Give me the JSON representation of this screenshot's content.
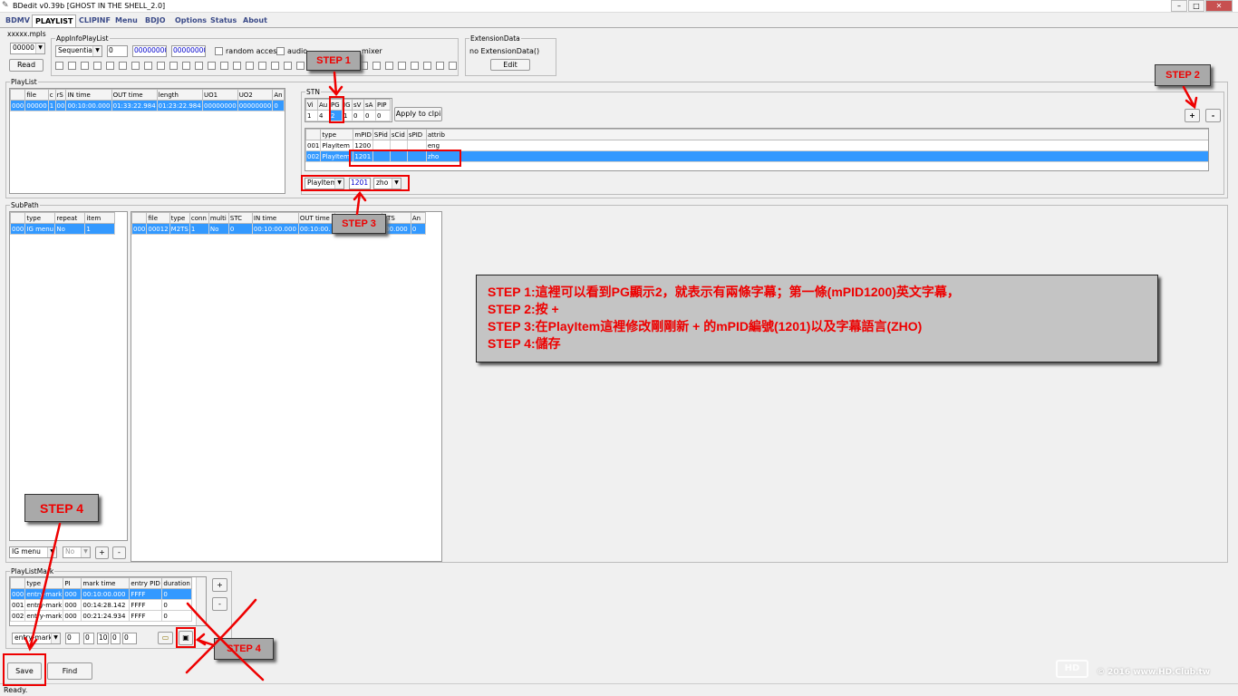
{
  "window": {
    "title": "BDedit v0.39b [GHOST IN THE SHELL_2.0]",
    "minimize": "–",
    "maximize": "□",
    "close": "✕"
  },
  "tabs": [
    "BDMV",
    "PLAYLIST",
    "CLIPINF",
    "Menu",
    "BDJO",
    "Options",
    "Status",
    "About"
  ],
  "file": {
    "label": "xxxxx.mpls",
    "number": "00000",
    "read_label": "Read"
  },
  "appinfo": {
    "label": "AppInfoPlayList",
    "mode": "Sequential",
    "count": "0",
    "hex1": "00000000",
    "hex2": "00000000",
    "random_access": "random access",
    "audio": "audio",
    "mixer": "mixer"
  },
  "extension": {
    "label": "ExtensionData",
    "text": "no ExtensionData()",
    "edit_label": "Edit"
  },
  "playlist": {
    "label": "PlayList",
    "columns": [
      "",
      "file",
      "c",
      "rS",
      "IN time",
      "OUT time",
      "length",
      "UO1",
      "UO2",
      "An"
    ],
    "rows": [
      [
        "000",
        "00000",
        "1",
        "00",
        "00:10:00.000",
        "01:33:22.984",
        "01:23:22.984",
        "00000000",
        "00000000",
        "0"
      ]
    ]
  },
  "stn": {
    "label": "STN",
    "counts_header": [
      "Vi",
      "Au",
      "PG",
      "IG",
      "sV",
      "sA",
      "PIP"
    ],
    "counts": [
      "1",
      "4",
      "2",
      "1",
      "0",
      "0",
      "0"
    ],
    "apply_label": "Apply to clpi",
    "plus_label": "+",
    "minus_label": "-",
    "columns": [
      "",
      "type",
      "mPID",
      "SPid",
      "sCid",
      "sPID",
      "attrib"
    ],
    "rows": [
      [
        "001",
        "PlayItem",
        "1200",
        "",
        "",
        "",
        "eng"
      ],
      [
        "002",
        "PlayItem",
        "1201",
        "",
        "",
        "",
        "zho"
      ]
    ],
    "edit_type": "PlayItem",
    "edit_pid": "1201",
    "edit_lang": "zho"
  },
  "subpath": {
    "label": "SubPath",
    "columns": [
      "",
      "type",
      "repeat",
      "item"
    ],
    "rows": [
      [
        "000",
        "IG menu",
        "No",
        "1"
      ]
    ],
    "type_select": "IG menu",
    "repeat_select": "No",
    "plus_label": "+",
    "minus_label": "-",
    "clip_columns": [
      "",
      "file",
      "type",
      "conn",
      "multi",
      "STC",
      "IN time",
      "OUT time",
      "",
      "PTS",
      "An"
    ],
    "clip_rows": [
      [
        "000",
        "00012",
        "M2TS",
        "1",
        "No",
        "0",
        "00:10:00.000",
        "00:10:00.",
        "",
        ":00.000",
        "0"
      ]
    ]
  },
  "marks": {
    "label": "PlayListMark",
    "columns": [
      "",
      "type",
      "PI",
      "mark time",
      "entry PID",
      "duration"
    ],
    "rows": [
      [
        "000",
        "entry-mark",
        "000",
        "00:10:00.000",
        "FFFF",
        "0"
      ],
      [
        "001",
        "entry-mark",
        "000",
        "00:14:28.142",
        "FFFF",
        "0"
      ],
      [
        "002",
        "entry-mark",
        "000",
        "00:21:24.934",
        "FFFF",
        "0"
      ]
    ],
    "type_select": "entry-mark",
    "fields": [
      "0",
      "0",
      "10",
      "0",
      "0"
    ],
    "plus_label": "+",
    "minus_label": "-"
  },
  "footer": {
    "save_label": "Save",
    "find_label": "Find",
    "status": "Ready.",
    "watermark": "© 2016 www.HD.Club.tw"
  },
  "steps": {
    "step1": "STEP 1",
    "step2": "STEP 2",
    "step3": "STEP 3",
    "step4": "STEP 4",
    "step4b": "STEP 4"
  },
  "instructions": [
    "STEP 1:這裡可以看到PG顯示2，就表示有兩條字幕；第一條(mPID1200)英文字幕，",
    "STEP 2:按 +",
    "STEP 3:在PlayItem這裡修改剛剛新 + 的mPID編號(1201)以及字幕語言(ZHO)",
    "STEP 4:儲存"
  ],
  "colors": {
    "selection": "#3399ff",
    "annotation_red": "#ee0000",
    "step_bg": "#a9a9a9"
  }
}
